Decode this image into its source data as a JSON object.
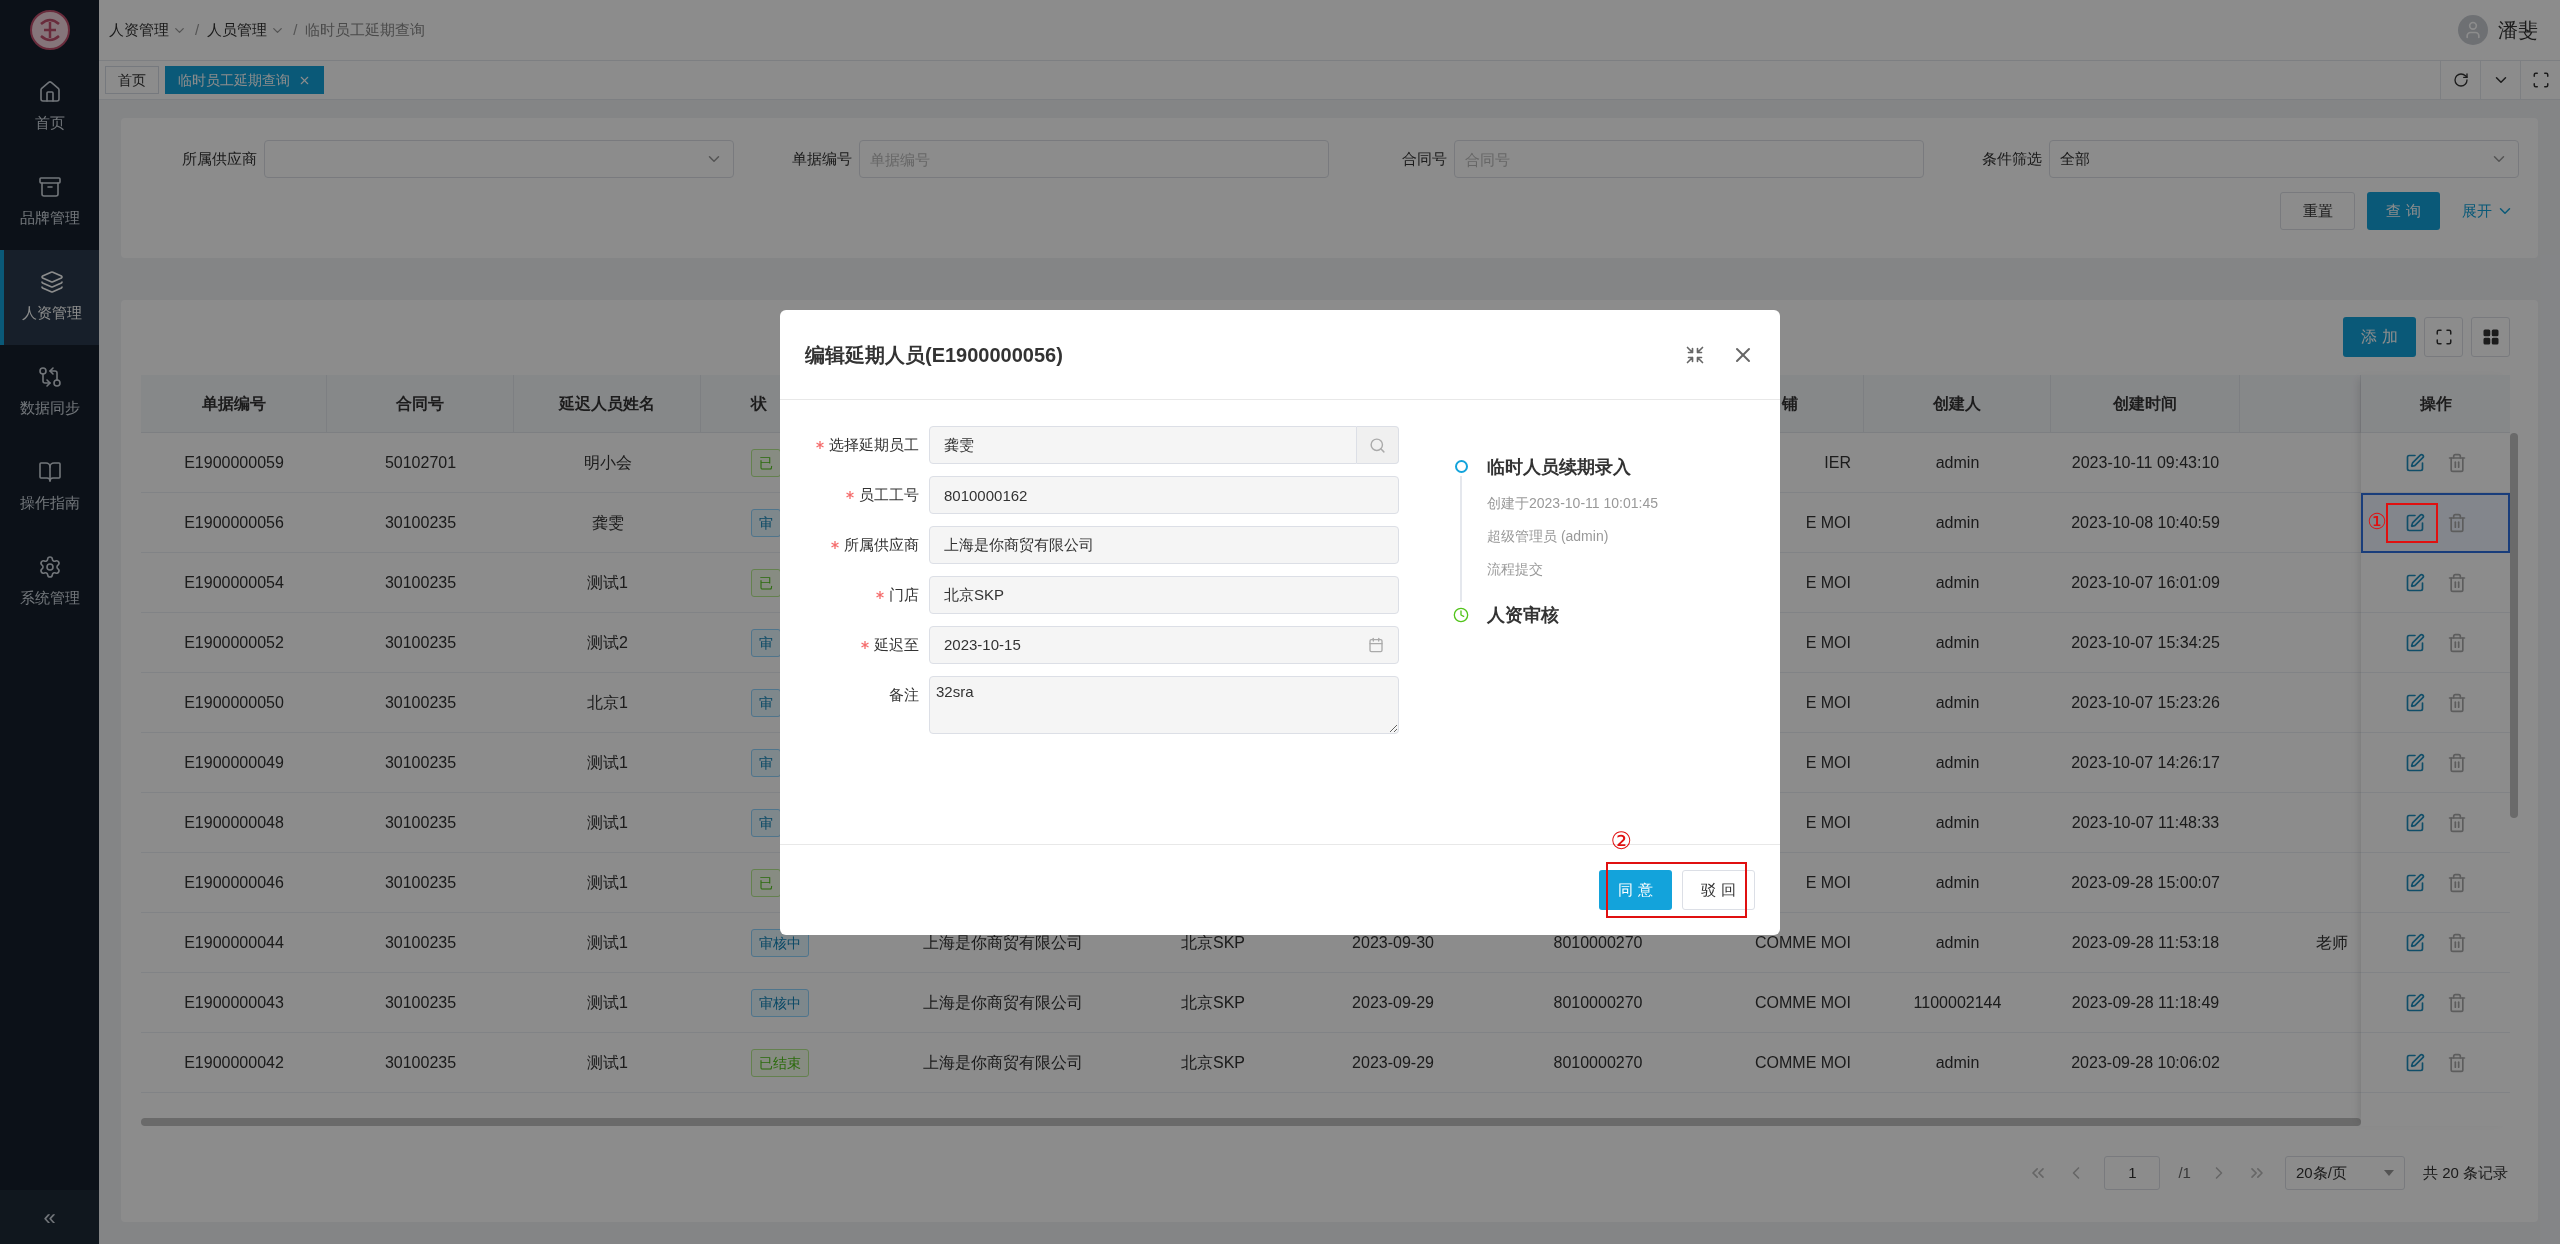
{
  "sidebar": {
    "items": [
      {
        "label": "首页",
        "selected": false
      },
      {
        "label": "品牌管理",
        "selected": false
      },
      {
        "label": "人资管理",
        "selected": true
      },
      {
        "label": "数据同步",
        "selected": false
      },
      {
        "label": "操作指南",
        "selected": false
      },
      {
        "label": "系统管理",
        "selected": false
      }
    ],
    "collapse": "«"
  },
  "header": {
    "breadcrumb": [
      {
        "label": "人资管理",
        "dropdown": true
      },
      {
        "label": "人员管理",
        "dropdown": true
      },
      {
        "label": "临时员工延期查询",
        "dropdown": false
      }
    ],
    "separator": "/",
    "user": "潘斐"
  },
  "tabs": [
    {
      "label": "首页",
      "selected": false,
      "closable": false
    },
    {
      "label": "临时员工延期查询",
      "selected": true,
      "closable": true
    }
  ],
  "filters": [
    {
      "label": "所属供应商",
      "kind": "select"
    },
    {
      "label": "单据编号",
      "kind": "input",
      "placeholder": "单据编号"
    },
    {
      "label": "合同号",
      "kind": "input",
      "placeholder": "合同号"
    },
    {
      "label": "条件筛选",
      "kind": "select",
      "value": "全部"
    }
  ],
  "filter_buttons": {
    "reset": "重置",
    "query": "查 询",
    "expand": "展开"
  },
  "table": {
    "add_button": "添 加",
    "header": {
      "doc_no": "单据编号",
      "contract_no": "合同号",
      "delayed_person": "延迟人员姓名",
      "status": "状",
      "column_9": "铺",
      "creator": "创建人",
      "created_at": "创建时间",
      "actions": "操作"
    },
    "rows": [
      {
        "doc_no": "E1900000059",
        "contract_no": "50102701",
        "delayed_person": "明小会",
        "status": {
          "label": "已",
          "kind": "done"
        },
        "column_9": "IER",
        "creator": "admin",
        "created_at": "2023-10-11 09:43:10",
        "selected": false
      },
      {
        "doc_no": "E1900000056",
        "contract_no": "30100235",
        "delayed_person": "龚雯",
        "status": {
          "label": "审",
          "kind": "review"
        },
        "column_9": "E MOI",
        "creator": "admin",
        "created_at": "2023-10-08 10:40:59",
        "selected": true,
        "annotation": "①"
      },
      {
        "doc_no": "E1900000054",
        "contract_no": "30100235",
        "delayed_person": "测试1",
        "status": {
          "label": "已",
          "kind": "done"
        },
        "column_9": "E MOI",
        "creator": "admin",
        "created_at": "2023-10-07 16:01:09",
        "selected": false
      },
      {
        "doc_no": "E1900000052",
        "contract_no": "30100235",
        "delayed_person": "测试2",
        "status": {
          "label": "审",
          "kind": "review"
        },
        "column_9": "E MOI",
        "creator": "admin",
        "created_at": "2023-10-07 15:34:25",
        "selected": false
      },
      {
        "doc_no": "E1900000050",
        "contract_no": "30100235",
        "delayed_person": "北京1",
        "status": {
          "label": "审",
          "kind": "review"
        },
        "column_9": "E MOI",
        "creator": "admin",
        "created_at": "2023-10-07 15:23:26",
        "selected": false
      },
      {
        "doc_no": "E1900000049",
        "contract_no": "30100235",
        "delayed_person": "测试1",
        "status": {
          "label": "审",
          "kind": "review"
        },
        "column_9": "E MOI",
        "creator": "admin",
        "created_at": "2023-10-07 14:26:17",
        "selected": false
      },
      {
        "doc_no": "E1900000048",
        "contract_no": "30100235",
        "delayed_person": "测试1",
        "status": {
          "label": "审",
          "kind": "review"
        },
        "column_9": "E MOI",
        "creator": "admin",
        "created_at": "2023-10-07 11:48:33",
        "selected": false
      },
      {
        "doc_no": "E1900000046",
        "contract_no": "30100235",
        "delayed_person": "测试1",
        "status": {
          "label": "已",
          "kind": "done"
        },
        "column_9": "E MOI",
        "creator": "admin",
        "created_at": "2023-09-28 15:00:07",
        "selected": false
      },
      {
        "doc_no": "E1900000044",
        "contract_no": "30100235",
        "delayed_person": "测试1",
        "status": {
          "label": "审核中",
          "kind": "review"
        },
        "column_5": "上海是你商贸有限公司",
        "column_6": "北京SKP",
        "column_7": "2023-09-30",
        "column_8": "8010000270",
        "column_9": "COMME MOI",
        "creator": "admin",
        "created_at": "2023-09-28 11:53:18",
        "column_12": "老师",
        "selected": false
      },
      {
        "doc_no": "E1900000043",
        "contract_no": "30100235",
        "delayed_person": "测试1",
        "status": {
          "label": "审核中",
          "kind": "review"
        },
        "column_5": "上海是你商贸有限公司",
        "column_6": "北京SKP",
        "column_7": "2023-09-29",
        "column_8": "8010000270",
        "column_9": "COMME MOI",
        "creator": "1100002144",
        "created_at": "2023-09-28 11:18:49",
        "selected": false
      },
      {
        "doc_no": "E1900000042",
        "contract_no": "30100235",
        "delayed_person": "测试1",
        "status": {
          "label": "已结束",
          "kind": "done"
        },
        "column_5": "上海是你商贸有限公司",
        "column_6": "北京SKP",
        "column_7": "2023-09-29",
        "column_8": "8010000270",
        "column_9": "COMME MOI",
        "creator": "admin",
        "created_at": "2023-09-28 10:06:02",
        "selected": false
      }
    ]
  },
  "pagination": {
    "page": "1",
    "total_pages": "/1",
    "page_size": "20条/页",
    "total": "共 20 条记录"
  },
  "modal": {
    "title": "编辑延期人员(E1900000056)",
    "fields": [
      {
        "label": "选择延期员工",
        "required": true,
        "kind": "search",
        "value": "龚雯"
      },
      {
        "label": "员工工号",
        "required": true,
        "kind": "text",
        "value": "8010000162"
      },
      {
        "label": "所属供应商",
        "required": true,
        "kind": "text",
        "value": "上海是你商贸有限公司"
      },
      {
        "label": "门店",
        "required": true,
        "kind": "text",
        "value": "北京SKP"
      },
      {
        "label": "延迟至",
        "required": true,
        "kind": "date",
        "value": "2023-10-15"
      },
      {
        "label": "备注",
        "required": false,
        "kind": "textarea",
        "value": "32sra"
      }
    ],
    "timeline": [
      {
        "title": "临时人员续期录入",
        "done": true,
        "lines": [
          "创建于2023-10-11 10:01:45",
          "超级管理员 (admin)",
          "流程提交"
        ]
      },
      {
        "title": "人资审核",
        "done": false
      }
    ],
    "buttons": [
      {
        "label": "同 意",
        "kind": "primary"
      },
      {
        "label": "驳 回",
        "kind": "default"
      }
    ],
    "footer_annotation": "②"
  }
}
